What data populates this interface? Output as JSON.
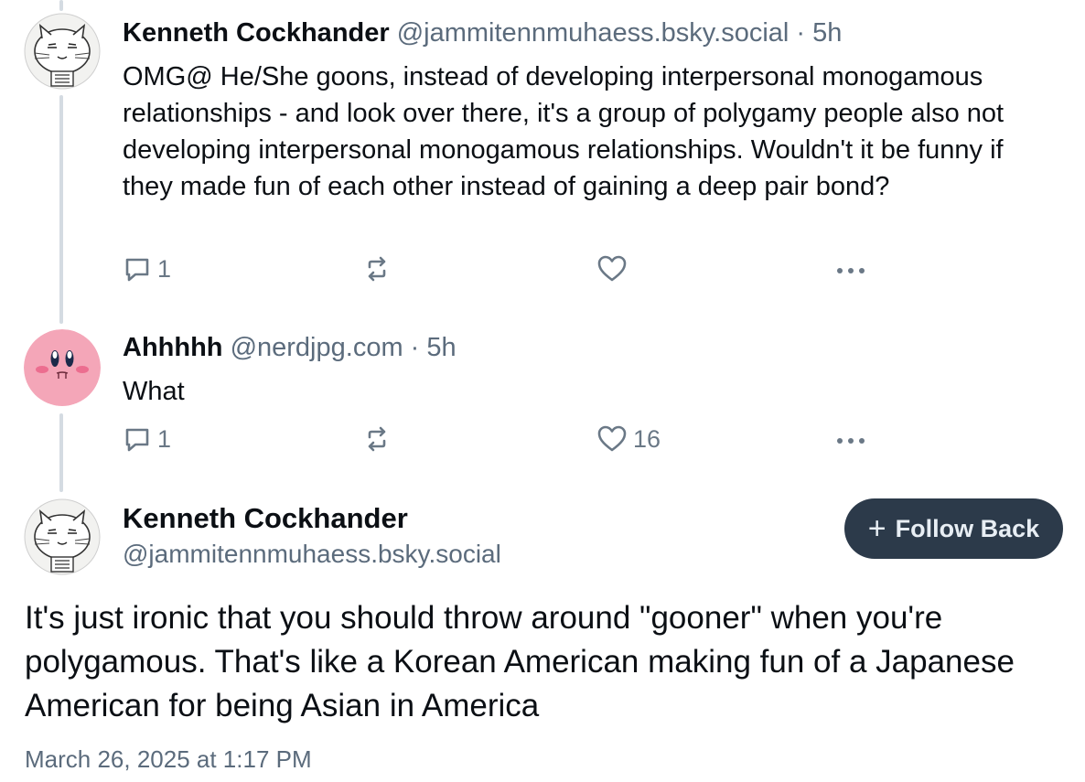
{
  "posts": [
    {
      "author": "Kenneth Cockhander",
      "handle": "@jammitennmuhaess.bsky.social",
      "separator": "·",
      "time": "5h",
      "text": "OMG@ He/She goons, instead of developing interpersonal monogamous relationships - and look over there, it's a group of polygamy people also not developing interpersonal monogamous relationships. Wouldn't it be funny if they made fun of each other instead of gaining a deep pair bond?",
      "reply_count": "1",
      "repost_count": "",
      "like_count": ""
    },
    {
      "author": "Ahhhhh",
      "handle": "@nerdjpg.com",
      "separator": "·",
      "time": "5h",
      "text": "What",
      "reply_count": "1",
      "repost_count": "",
      "like_count": "16"
    }
  ],
  "focus_post": {
    "author": "Kenneth Cockhander",
    "handle": "@jammitennmuhaess.bsky.social",
    "follow_label": "Follow Back",
    "text": "It's just ironic that you should throw around \"gooner\" when you're polygamous. That's like a Korean American making fun of a Japanese American for being Asian in America",
    "date": "March 26, 2025 at 1:17 PM"
  },
  "icons": {
    "reply": "reply-icon",
    "repost": "repost-icon",
    "like": "heart-icon",
    "more": "more-icon",
    "follow": "plus-icon"
  },
  "colors": {
    "follow_button_bg": "#2c3a4a",
    "secondary_text": "#5b6b7c",
    "kirby_pink": "#f4a6b8"
  }
}
